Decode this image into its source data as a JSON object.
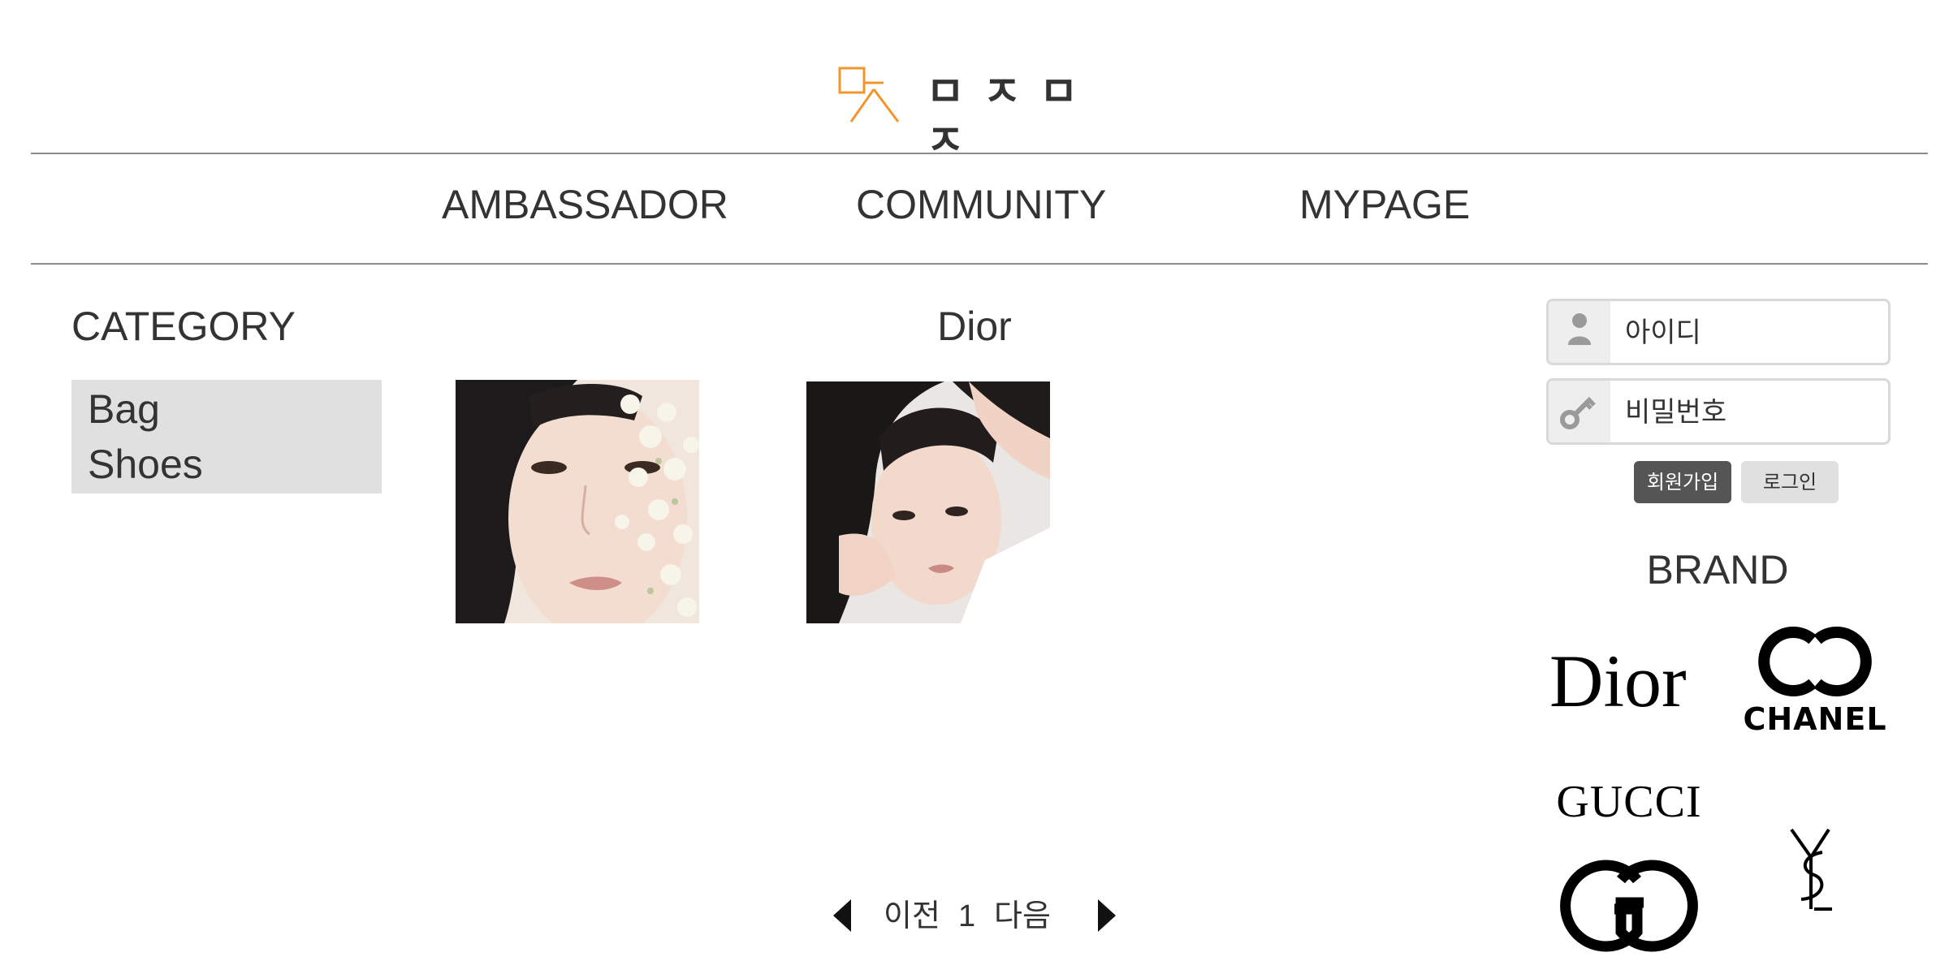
{
  "header": {
    "logo_text": "ㅁㅈㅁㅈ",
    "logo_color": "#f0962a"
  },
  "nav": {
    "items": [
      "AMBASSADOR",
      "COMMUNITY",
      "MYPAGE"
    ]
  },
  "category": {
    "title": "CATEGORY",
    "items": [
      "Bag",
      "Shoes"
    ]
  },
  "main": {
    "brand_heading": "Dior",
    "products": [
      "jisoo-portrait",
      "suzy-portrait"
    ]
  },
  "pagination": {
    "prev_label": "이전",
    "current_page": "1",
    "next_label": "다음"
  },
  "login": {
    "id_placeholder": "아이디",
    "password_placeholder": "비밀번호",
    "signup_label": "회원가입",
    "login_label": "로그인",
    "signup_color": "#555555",
    "login_color": "#e0e0e0"
  },
  "brand": {
    "title": "BRAND",
    "logos": {
      "dior": "Dior",
      "chanel": "CHANEL",
      "gucci": "GUCCI"
    }
  },
  "icons": [
    "user-icon",
    "key-icon",
    "triangle-left-icon",
    "triangle-right-icon"
  ]
}
